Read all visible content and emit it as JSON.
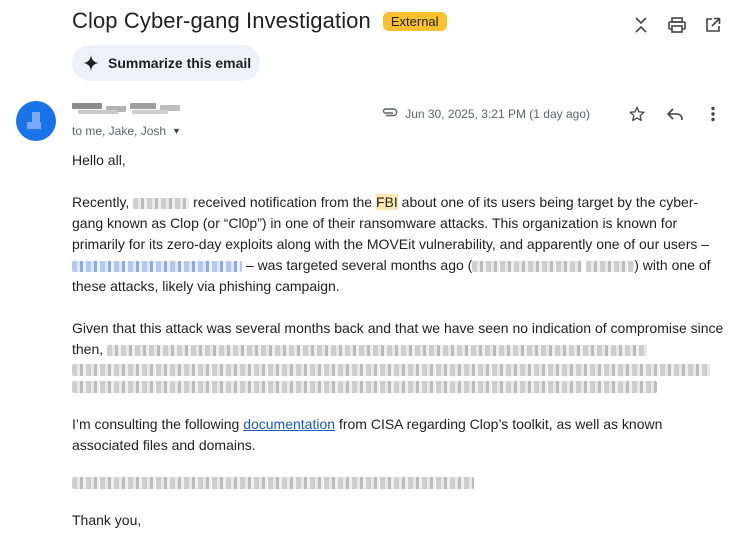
{
  "email": {
    "subject": "Clop Cyber-gang Investigation",
    "badge": "External",
    "summarize_label": "Summarize this email",
    "recipients": "to me, Jake, Josh",
    "date": "Jun 30, 2025, 3:21 PM (1 day ago)"
  },
  "body": {
    "greeting": "Hello all,",
    "p1_a": "Recently,",
    "p1_b": "received notification from the",
    "p1_fbi": "FBI",
    "p1_c": "about one of its users being target by the cyber-gang known as Clop (or “Cl0p”) in one of their ransomware attacks. This organization is known for primarily for its zero-day exploits along with the MOVEit vulnerability, and apparently one of our users –",
    "p1_d": "– was targeted several months ago (",
    "p1_e": ") with one of these attacks, likely via phishing campaign.",
    "p2_a": "Given that this attack was several months back and that we have seen no indication of compromise since then,",
    "p3_a": "I’m consulting the following",
    "p3_link": "documentation",
    "p3_b": "from CISA regarding Clop’s toolkit, as well as known associated files and domains.",
    "closing": "Thank you,"
  },
  "icons": {
    "collapse": "unfold-less-icon",
    "print": "printer-icon",
    "popout": "open-in-new-icon",
    "sparkle": "sparkle-icon",
    "attachment": "paperclip-icon",
    "star": "star-icon",
    "reply": "reply-icon",
    "more": "more-vert-icon"
  },
  "colors": {
    "badge": "#fbc02d",
    "highlight": "#fce8b2",
    "link": "#1a5bb5",
    "avatar": "#1a73e8"
  }
}
